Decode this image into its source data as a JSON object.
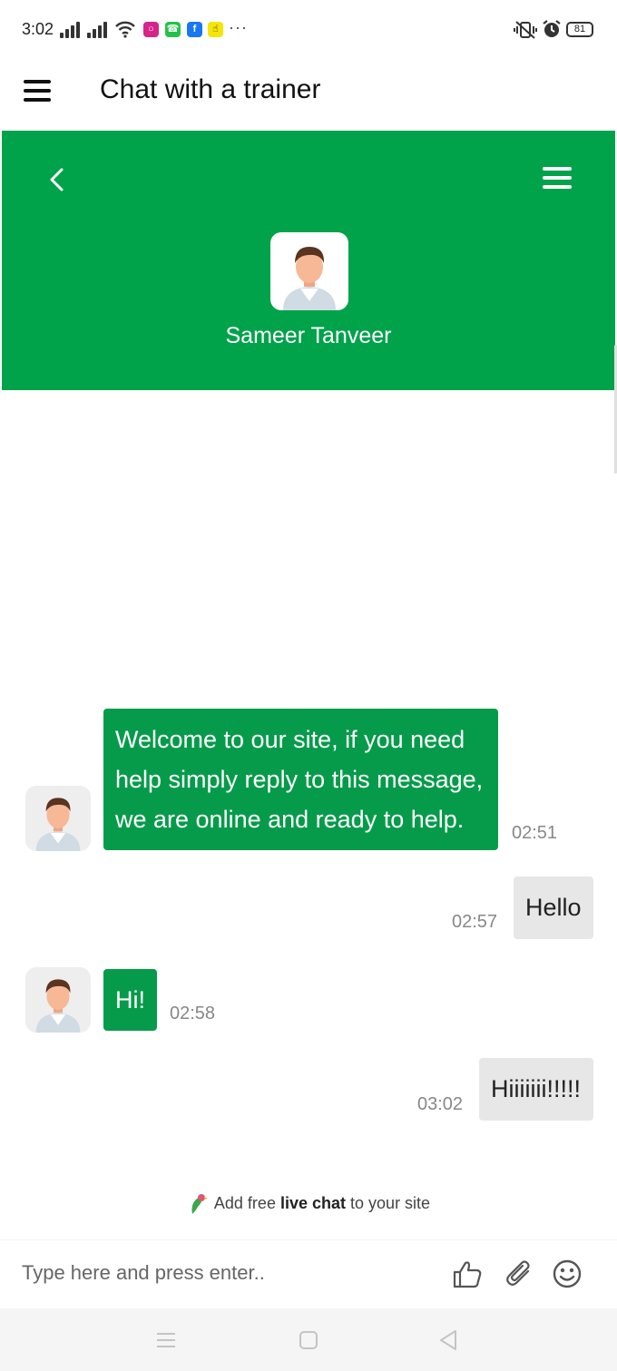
{
  "status_bar": {
    "time": "3:02",
    "battery": "81",
    "more": "···",
    "app_icons": [
      "instagram-icon",
      "whatsapp-icon",
      "facebook-icon",
      "snapchat-icon"
    ]
  },
  "header": {
    "title": "Chat with a trainer"
  },
  "chat_header": {
    "agent_name": "Sameer Tanveer"
  },
  "messages": [
    {
      "from": "agent",
      "text": "Welcome to our site, if you need help simply reply to this message, we are online and ready to help.",
      "time": "02:51"
    },
    {
      "from": "user",
      "text": "Hello",
      "time": "02:57"
    },
    {
      "from": "agent",
      "text": "Hi!",
      "time": "02:58"
    },
    {
      "from": "user",
      "text": "Hiiiiiii!!!!!",
      "time": "03:02"
    }
  ],
  "branding": {
    "prefix": "Add free",
    "bold": "live chat",
    "suffix": "to your site"
  },
  "composer": {
    "placeholder": "Type here and press enter.."
  },
  "colors": {
    "brand_green": "#00a24a",
    "agent_bubble": "#069b4a",
    "user_bubble": "#e7e7e7"
  }
}
